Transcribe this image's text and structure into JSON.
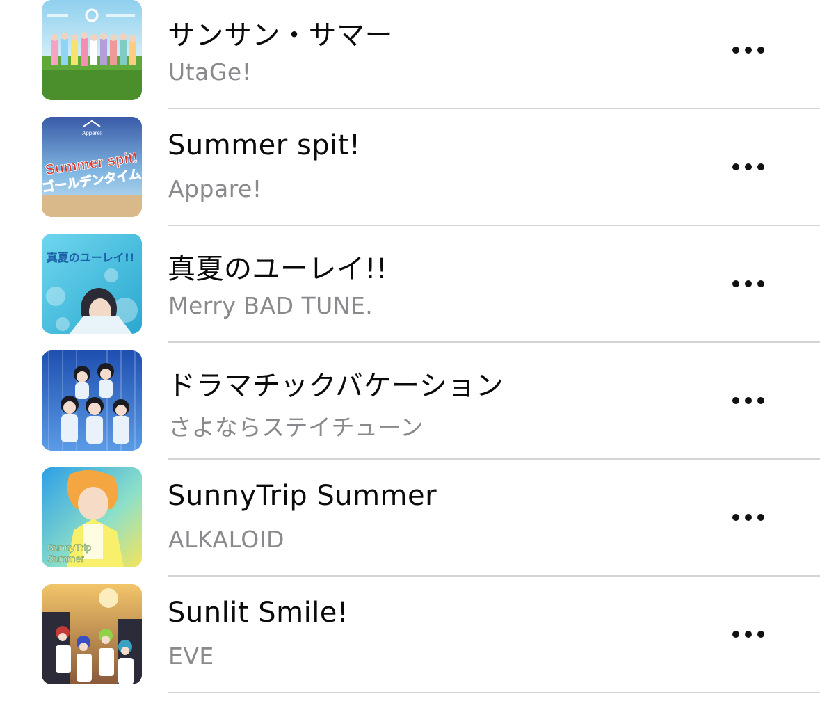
{
  "songs": [
    {
      "title": "サンサン・サマー",
      "artist": "UtaGe!"
    },
    {
      "title": "Summer spit!",
      "artist": "Appare!"
    },
    {
      "title": "真夏のユーレイ!!",
      "artist": "Merry BAD TUNE."
    },
    {
      "title": "ドラマチックバケーション",
      "artist": "さよならステイチューン"
    },
    {
      "title": "SunnyTrip Summer",
      "artist": "ALKALOID"
    },
    {
      "title": "Sunlit Smile!",
      "artist": "EVE"
    }
  ],
  "artwork_text": {
    "summer_spit_logo": "Appare!",
    "summer_spit_line1": "Summer spit!",
    "summer_spit_line2": "ゴールデンタイム",
    "mayonaka_title": "真夏のユーレイ!!",
    "sunnytrip_line1": "SunnyTrip",
    "sunnytrip_line2": "Summer"
  },
  "icons": {
    "more": "ellipsis-horizontal-icon"
  }
}
